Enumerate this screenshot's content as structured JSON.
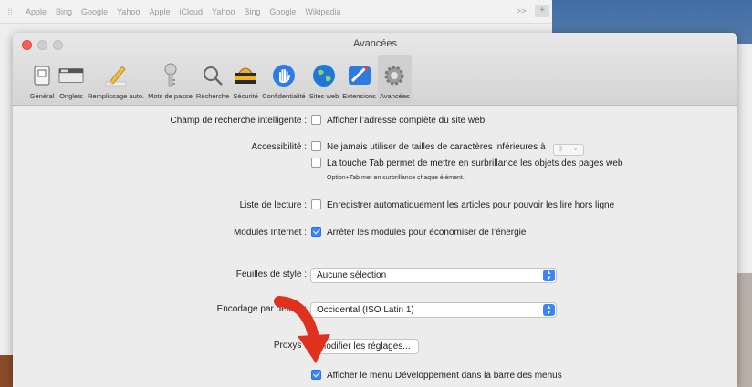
{
  "background_browser": {
    "bookmarks": [
      "Apple",
      "Bing",
      "Google",
      "Yahoo",
      "Apple",
      "iCloud",
      "Yahoo",
      "Bing",
      "Google",
      "Wikipedia"
    ],
    "more_label": ">>",
    "add_label": "+"
  },
  "window": {
    "title": "Avancées"
  },
  "toolbar": {
    "items": [
      {
        "label": "Général",
        "icon": "general-switch-icon"
      },
      {
        "label": "Onglets",
        "icon": "tabs-icon"
      },
      {
        "label": "Remplissage auto.",
        "icon": "pencil-icon"
      },
      {
        "label": "Mots de passe",
        "icon": "key-icon"
      },
      {
        "label": "Recherche",
        "icon": "search-icon"
      },
      {
        "label": "Sécurité",
        "icon": "security-icon"
      },
      {
        "label": "Confidentialité",
        "icon": "privacy-hand-icon"
      },
      {
        "label": "Sites web",
        "icon": "globe-icon"
      },
      {
        "label": "Extensions",
        "icon": "extensions-icon"
      },
      {
        "label": "Avancées",
        "icon": "gear-icon"
      }
    ],
    "selected": "Avancées"
  },
  "settings": {
    "smart_search": {
      "label": "Champ de recherche intelligente :",
      "option": "Afficher l’adresse complète du site web",
      "checked": false
    },
    "accessibility": {
      "label": "Accessibilité :",
      "option1": "Ne jamais utiliser de tailles de caractères inférieures à",
      "option1_value": "9",
      "option1_checked": false,
      "option2": "La touche Tab permet de mettre en surbrillance les objets des pages web",
      "option2_checked": false,
      "option2_hint": "Option+Tab met en surbrillance chaque élément."
    },
    "reading_list": {
      "label": "Liste de lecture :",
      "option": "Enregistrer automatiquement les articles pour pouvoir les lire hors ligne",
      "checked": false
    },
    "internet_plugins": {
      "label": "Modules Internet :",
      "option": "Arrêter les modules pour économiser de l’énergie",
      "checked": true
    },
    "style_sheets": {
      "label": "Feuilles de style :",
      "value": "Aucune sélection"
    },
    "default_encoding": {
      "label": "Encodage par défaut :",
      "value": "Occidental (ISO Latin 1)"
    },
    "proxies": {
      "label": "Proxys :",
      "button": "Modifier les réglages..."
    },
    "develop_menu": {
      "option": "Afficher le menu Développement dans la barre des menus",
      "checked": true
    }
  },
  "colors": {
    "accent": "#3b86f7",
    "arrow": "#e0301e",
    "close": "#fc5d57"
  }
}
